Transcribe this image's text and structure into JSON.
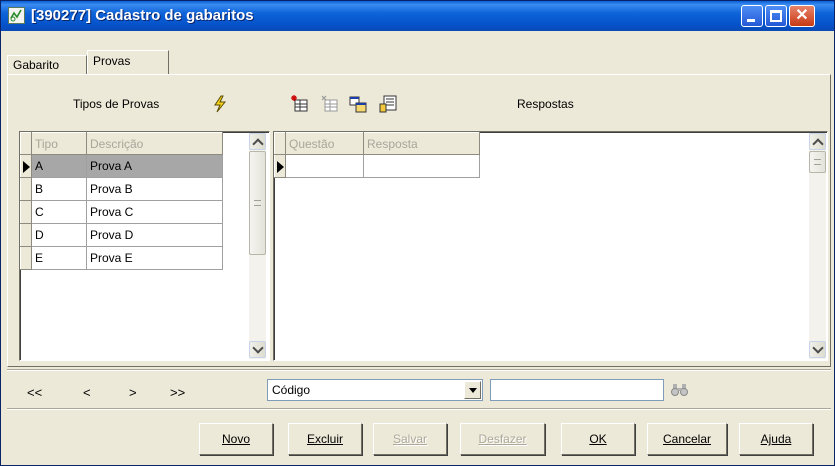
{
  "window": {
    "title": "[390277]  Cadastro de gabaritos",
    "controls": {
      "minimize": "minimize-icon",
      "maximize": "maximize-icon",
      "close": "close-icon"
    }
  },
  "tabs": [
    {
      "label": "Gabarito",
      "active": false
    },
    {
      "label": "Provas",
      "active": true
    }
  ],
  "toolbar": {
    "tipos_label": "Tipos de Provas",
    "respostas_label": "Respostas",
    "icons": [
      "lightning-icon",
      "new-record-icon",
      "delete-record-icon",
      "copy-icon",
      "import-icon"
    ]
  },
  "tipos_grid": {
    "columns": [
      "Tipo",
      "Descrição"
    ],
    "rows": [
      {
        "tipo": "A",
        "descricao": "Prova A"
      },
      {
        "tipo": "B",
        "descricao": "Prova B"
      },
      {
        "tipo": "C",
        "descricao": "Prova C"
      },
      {
        "tipo": "D",
        "descricao": "Prova D"
      },
      {
        "tipo": "E",
        "descricao": "Prova E"
      }
    ],
    "selected_row": 0
  },
  "respostas_grid": {
    "columns": [
      "Questão",
      "Resposta"
    ],
    "rows": [
      {
        "questao": "",
        "resposta": ""
      }
    ]
  },
  "navigation": {
    "first": "<<",
    "prev": "<",
    "next": ">",
    "last": ">>",
    "search_field": "Código",
    "search_value": "",
    "search_icon": "binoculars-icon"
  },
  "buttons": {
    "novo": "Novo",
    "excluir": "Excluir",
    "salvar": "Salvar",
    "desfazer": "Desfazer",
    "ok": "OK",
    "cancelar": "Cancelar",
    "ajuda": "Ajuda"
  },
  "colors": {
    "titlebar": "#0a5fd8",
    "window_bg": "#ece9d8",
    "selected_row": "#a7a7a7",
    "disabled_text": "#aca899"
  }
}
